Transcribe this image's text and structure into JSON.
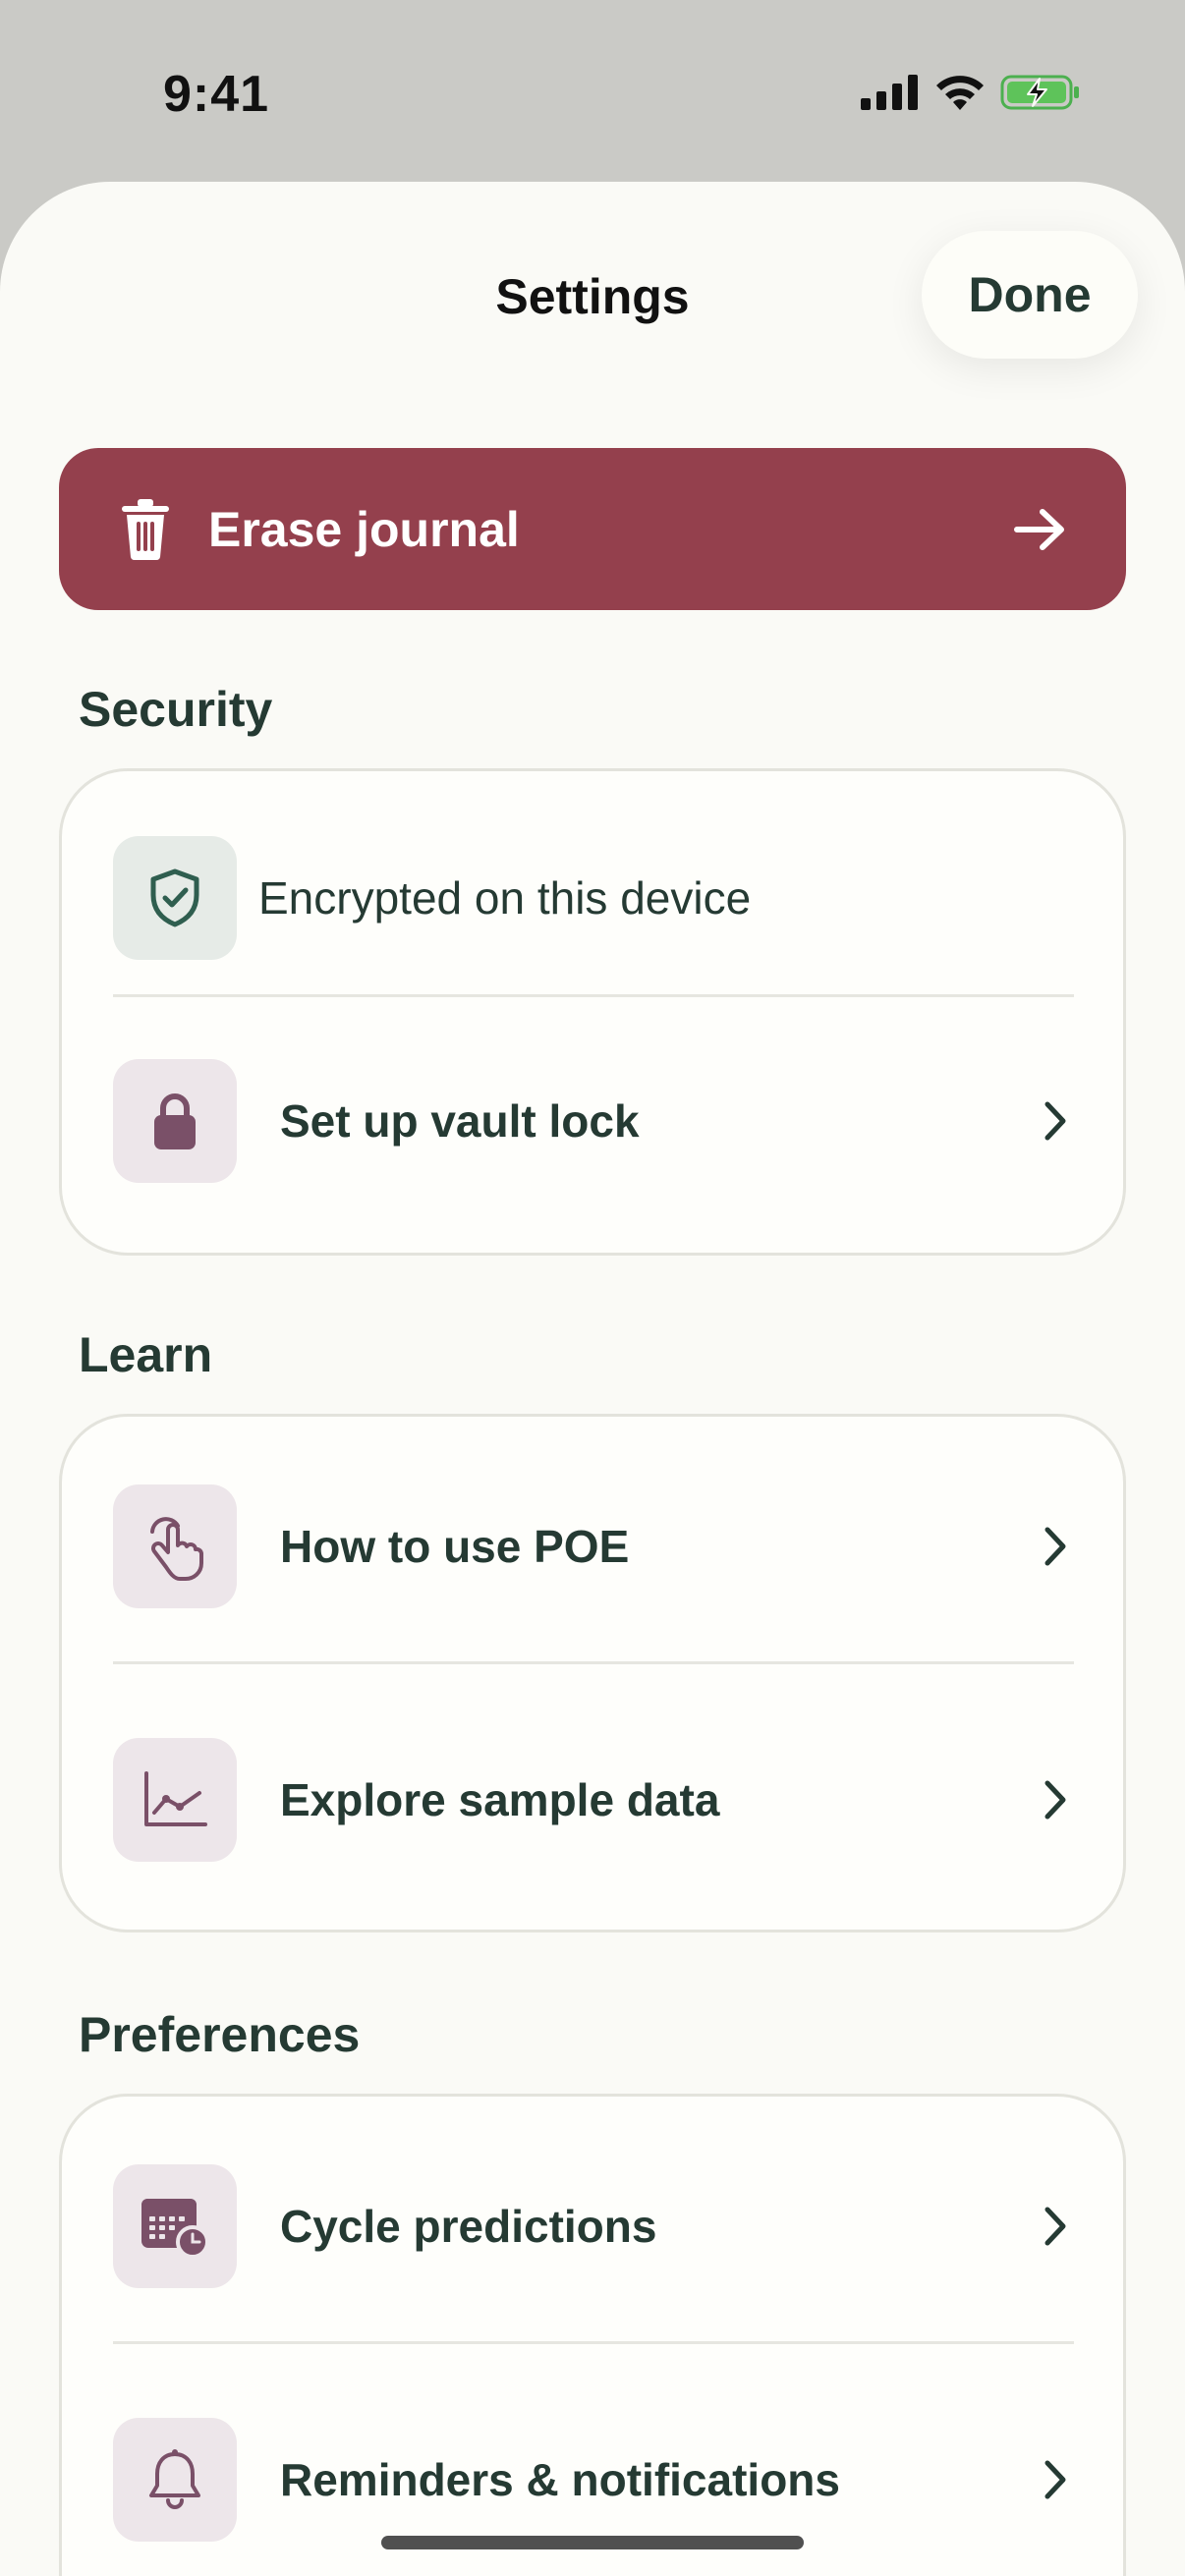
{
  "status_bar": {
    "time": "9:41"
  },
  "header": {
    "title": "Settings",
    "done_label": "Done"
  },
  "erase": {
    "label": "Erase journal"
  },
  "sections": {
    "security": {
      "title": "Security",
      "items": [
        {
          "label": "Encrypted on this device",
          "icon": "shield-check-icon"
        },
        {
          "label": "Set up vault lock",
          "icon": "lock-icon"
        }
      ]
    },
    "learn": {
      "title": "Learn",
      "items": [
        {
          "label": "How to use POE",
          "icon": "tap-hand-icon"
        },
        {
          "label": "Explore sample data",
          "icon": "chart-line-icon"
        }
      ]
    },
    "preferences": {
      "title": "Preferences",
      "items": [
        {
          "label": "Cycle predictions",
          "icon": "calendar-clock-icon"
        },
        {
          "label": "Reminders & notifications",
          "icon": "bell-icon"
        }
      ]
    }
  },
  "colors": {
    "accent": "#94404d",
    "icon_purple": "#7a5068",
    "icon_green": "#2f5e4f",
    "text": "#253a33",
    "sheet_bg": "#fafaf6"
  }
}
